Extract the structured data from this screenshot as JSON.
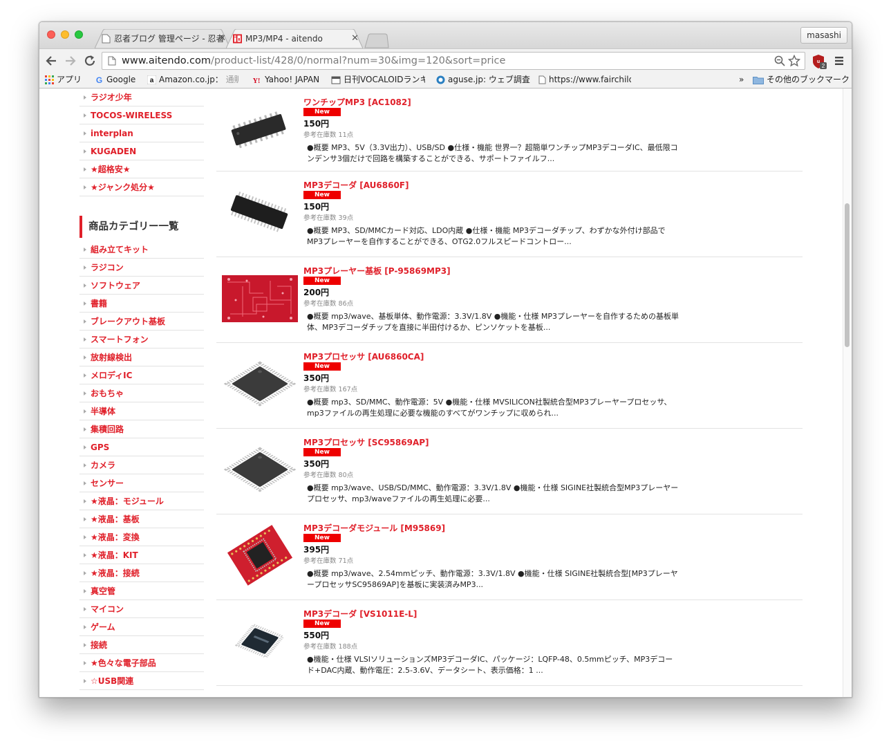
{
  "browser": {
    "tabs": [
      {
        "label": "忍者ブログ 管理ページ - 忍者"
      },
      {
        "label": "MP3/MP4 - aitendo"
      }
    ],
    "profile_name": "masashi",
    "url_host": "www.aitendo.com",
    "url_path": "/product-list/428/0/normal?num=30&img=120&sort=price",
    "ub_badge": "2",
    "bookmarks": [
      {
        "label": "アプリ"
      },
      {
        "label": "Google"
      },
      {
        "label": "Amazon.co.jp：",
        "faded": "通販"
      },
      {
        "label": "Yahoo! JAPAN"
      },
      {
        "label": "日刊VOCALOIDランキ"
      },
      {
        "label": "aguse.jp: ウェブ調査"
      },
      {
        "label": "https://www.fairchild"
      }
    ],
    "bookmarks_overflow": "»",
    "other_bookmarks": "その他のブックマーク"
  },
  "sidebar": {
    "brand_items": [
      "ラジオ少年",
      "TOCOS-WIRELESS",
      "interplan",
      "KUGADEN",
      "★超格安★",
      "★ジャンク処分★"
    ],
    "category_heading": "商品カテゴリー一覧",
    "category_items": [
      "組み立てキット",
      "ラジコン",
      "ソフトウェア",
      "書籍",
      "ブレークアウト基板",
      "スマートフォン",
      "放射線検出",
      "メロディIC",
      "おもちゃ",
      "半導体",
      "集積回路",
      "GPS",
      "カメラ",
      "センサー",
      "★液晶：モジュール",
      "★液晶：基板",
      "★液晶：変換",
      "★液晶：KIT",
      "★液晶：接続",
      "真空管",
      "マイコン",
      "ゲーム",
      "接続",
      "★色々な電子部品",
      "☆USB関連"
    ]
  },
  "products": [
    {
      "title": "ワンチップMP3 [AC1082]",
      "badge": "New",
      "price": "150円",
      "stock": "参考在庫数 11点",
      "desc": "●概要 MP3、5V（3.3V出力）、USB/SD ●仕様・機能 世界一？超簡単ワンチップMP3デコーダIC、最低限コンデンサ3個だけで回路を構築することができる、サポートファイルフ...",
      "image": "soic-chip"
    },
    {
      "title": "MP3デコーダ [AU6860F]",
      "badge": "New",
      "price": "150円",
      "stock": "参考在庫数 39点",
      "desc": "●概要 MP3、SD/MMCカード対応、LDO内蔵 ●仕様・機能 MP3デコーダチップ、わずかな外付け部品でMP3プレーヤーを自作することができる、OTG2.0フルスピードコントロー...",
      "image": "ssop-chip"
    },
    {
      "title": "MP3プレーヤー基板 [P-95869MP3]",
      "badge": "New",
      "price": "200円",
      "stock": "参考在庫数 86点",
      "desc": "●概要 mp3/wave、基板単体、動作電源：3.3V/1.8V ●機能・仕様 MP3プレーヤーを自作するための基板単体、MP3デコーダチップを直接に半田付けるか、ピンソケットを基板...",
      "image": "red-pcb"
    },
    {
      "title": "MP3プロセッサ [AU6860CA]",
      "badge": "New",
      "price": "350円",
      "stock": "参考在庫数 167点",
      "desc": "●概要 mp3、SD/MMC、動作電源：5V ●機能・仕様 MVSILICON社製統合型MP3プレーヤープロセッサ、mp3ファイルの再生処理に必要な機能のすべてがワンチップに収められ...",
      "image": "qfp-chip"
    },
    {
      "title": "MP3プロセッサ [SC95869AP]",
      "badge": "New",
      "price": "350円",
      "stock": "参考在庫数 80点",
      "desc": "●概要 mp3/wave、USB/SD/MMC、動作電源：3.3V/1.8V ●機能・仕様 SIGINE社製統合型MP3プレーヤープロセッサ、mp3/waveファイルの再生処理に必要...",
      "image": "qfp-chip"
    },
    {
      "title": "MP3デコーダモジュール [M95869]",
      "badge": "New",
      "price": "395円",
      "stock": "参考在庫数 71点",
      "desc": "●概要 mp3/wave、2.54mmピッチ、動作電源：3.3V/1.8V ●機能・仕様 SIGINE社製統合型[MP3プレーヤープロセッサSC95869AP]を基板に実装済みMP3...",
      "image": "red-module"
    },
    {
      "title": "MP3デコーダ [VS1011E-L]",
      "badge": "New",
      "price": "550円",
      "stock": "参考在庫数 188点",
      "desc": "●機能・仕様 VLSIソリューションズMP3デコーダIC、パッケージ：LQFP-48、0.5mmピッチ、MP3デコード+DAC内蔵、動作電圧：2.5-3.6V、データシート、表示価格：1 ...",
      "image": "lqfp-chip"
    }
  ],
  "colors": {
    "accent": "#e0202a",
    "badge": "#ee0000"
  }
}
